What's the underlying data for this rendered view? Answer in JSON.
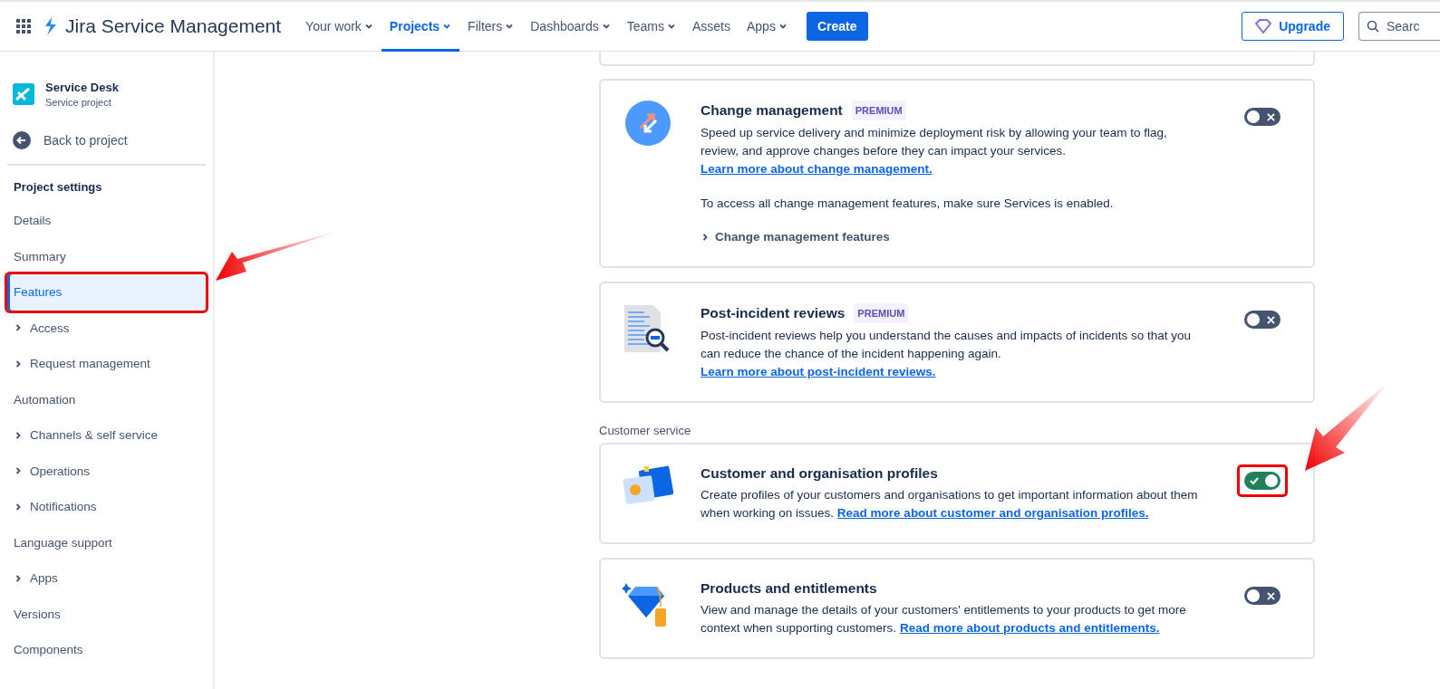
{
  "topbar": {
    "product": "Jira Service Management",
    "nav": [
      {
        "label": "Your work",
        "dropdown": true,
        "selected": false
      },
      {
        "label": "Projects",
        "dropdown": true,
        "selected": true
      },
      {
        "label": "Filters",
        "dropdown": true,
        "selected": false
      },
      {
        "label": "Dashboards",
        "dropdown": true,
        "selected": false
      },
      {
        "label": "Teams",
        "dropdown": true,
        "selected": false
      },
      {
        "label": "Assets",
        "dropdown": false,
        "selected": false
      },
      {
        "label": "Apps",
        "dropdown": true,
        "selected": false
      }
    ],
    "create": "Create",
    "upgrade": "Upgrade",
    "search": {
      "placeholder": "Searc"
    }
  },
  "sidebar": {
    "project_name": "Service Desk",
    "project_type": "Service project",
    "back": "Back to project",
    "heading": "Project settings",
    "items": [
      {
        "label": "Details",
        "expandable": false,
        "selected": false,
        "annotated": false
      },
      {
        "label": "Summary",
        "expandable": false,
        "selected": false,
        "annotated": false
      },
      {
        "label": "Features",
        "expandable": false,
        "selected": true,
        "annotated": true
      },
      {
        "label": "Access",
        "expandable": true,
        "selected": false,
        "annotated": false
      },
      {
        "label": "Request management",
        "expandable": true,
        "selected": false,
        "annotated": false
      },
      {
        "label": "Automation",
        "expandable": false,
        "selected": false,
        "annotated": false
      },
      {
        "label": "Channels & self service",
        "expandable": true,
        "selected": false,
        "annotated": false
      },
      {
        "label": "Operations",
        "expandable": true,
        "selected": false,
        "annotated": false
      },
      {
        "label": "Notifications",
        "expandable": true,
        "selected": false,
        "annotated": false
      },
      {
        "label": "Language support",
        "expandable": false,
        "selected": false,
        "annotated": false
      },
      {
        "label": "Apps",
        "expandable": true,
        "selected": false,
        "annotated": false
      },
      {
        "label": "Versions",
        "expandable": false,
        "selected": false,
        "annotated": false
      },
      {
        "label": "Components",
        "expandable": false,
        "selected": false,
        "annotated": false
      }
    ]
  },
  "sections": [
    {
      "features": [
        {
          "kind": "change",
          "title": "Change management",
          "badge": "PREMIUM",
          "description": "Speed up service delivery and minimize deployment risk by allowing your team to flag, review, and approve changes before they can impact your services.",
          "link": "Learn more about change management.",
          "link_inline": false,
          "note": "To access all change management features, make sure Services is enabled.",
          "expander": "Change management features",
          "on": false,
          "annotated": false
        },
        {
          "kind": "review",
          "title": "Post-incident reviews",
          "badge": "PREMIUM",
          "description": "Post-incident reviews help you understand the causes and impacts of incidents so that you can reduce the chance of the incident happening again.",
          "link": "Learn more about post-incident reviews.",
          "link_inline": false,
          "on": false,
          "annotated": false
        }
      ]
    },
    {
      "heading": "Customer service",
      "features": [
        {
          "kind": "profile",
          "title": "Customer and organisation profiles",
          "description": "Create profiles of your customers and organisations to get important information about them when working on issues.",
          "link": "Read more about customer and organisation profiles.",
          "link_inline": true,
          "on": true,
          "annotated": true
        },
        {
          "kind": "product",
          "title": "Products and entitlements",
          "description": "View and manage the details of your customers' entitlements to your products to get more context when supporting customers.",
          "link": "Read more about products and entitlements.",
          "link_inline": true,
          "on": false,
          "annotated": false
        }
      ]
    }
  ]
}
